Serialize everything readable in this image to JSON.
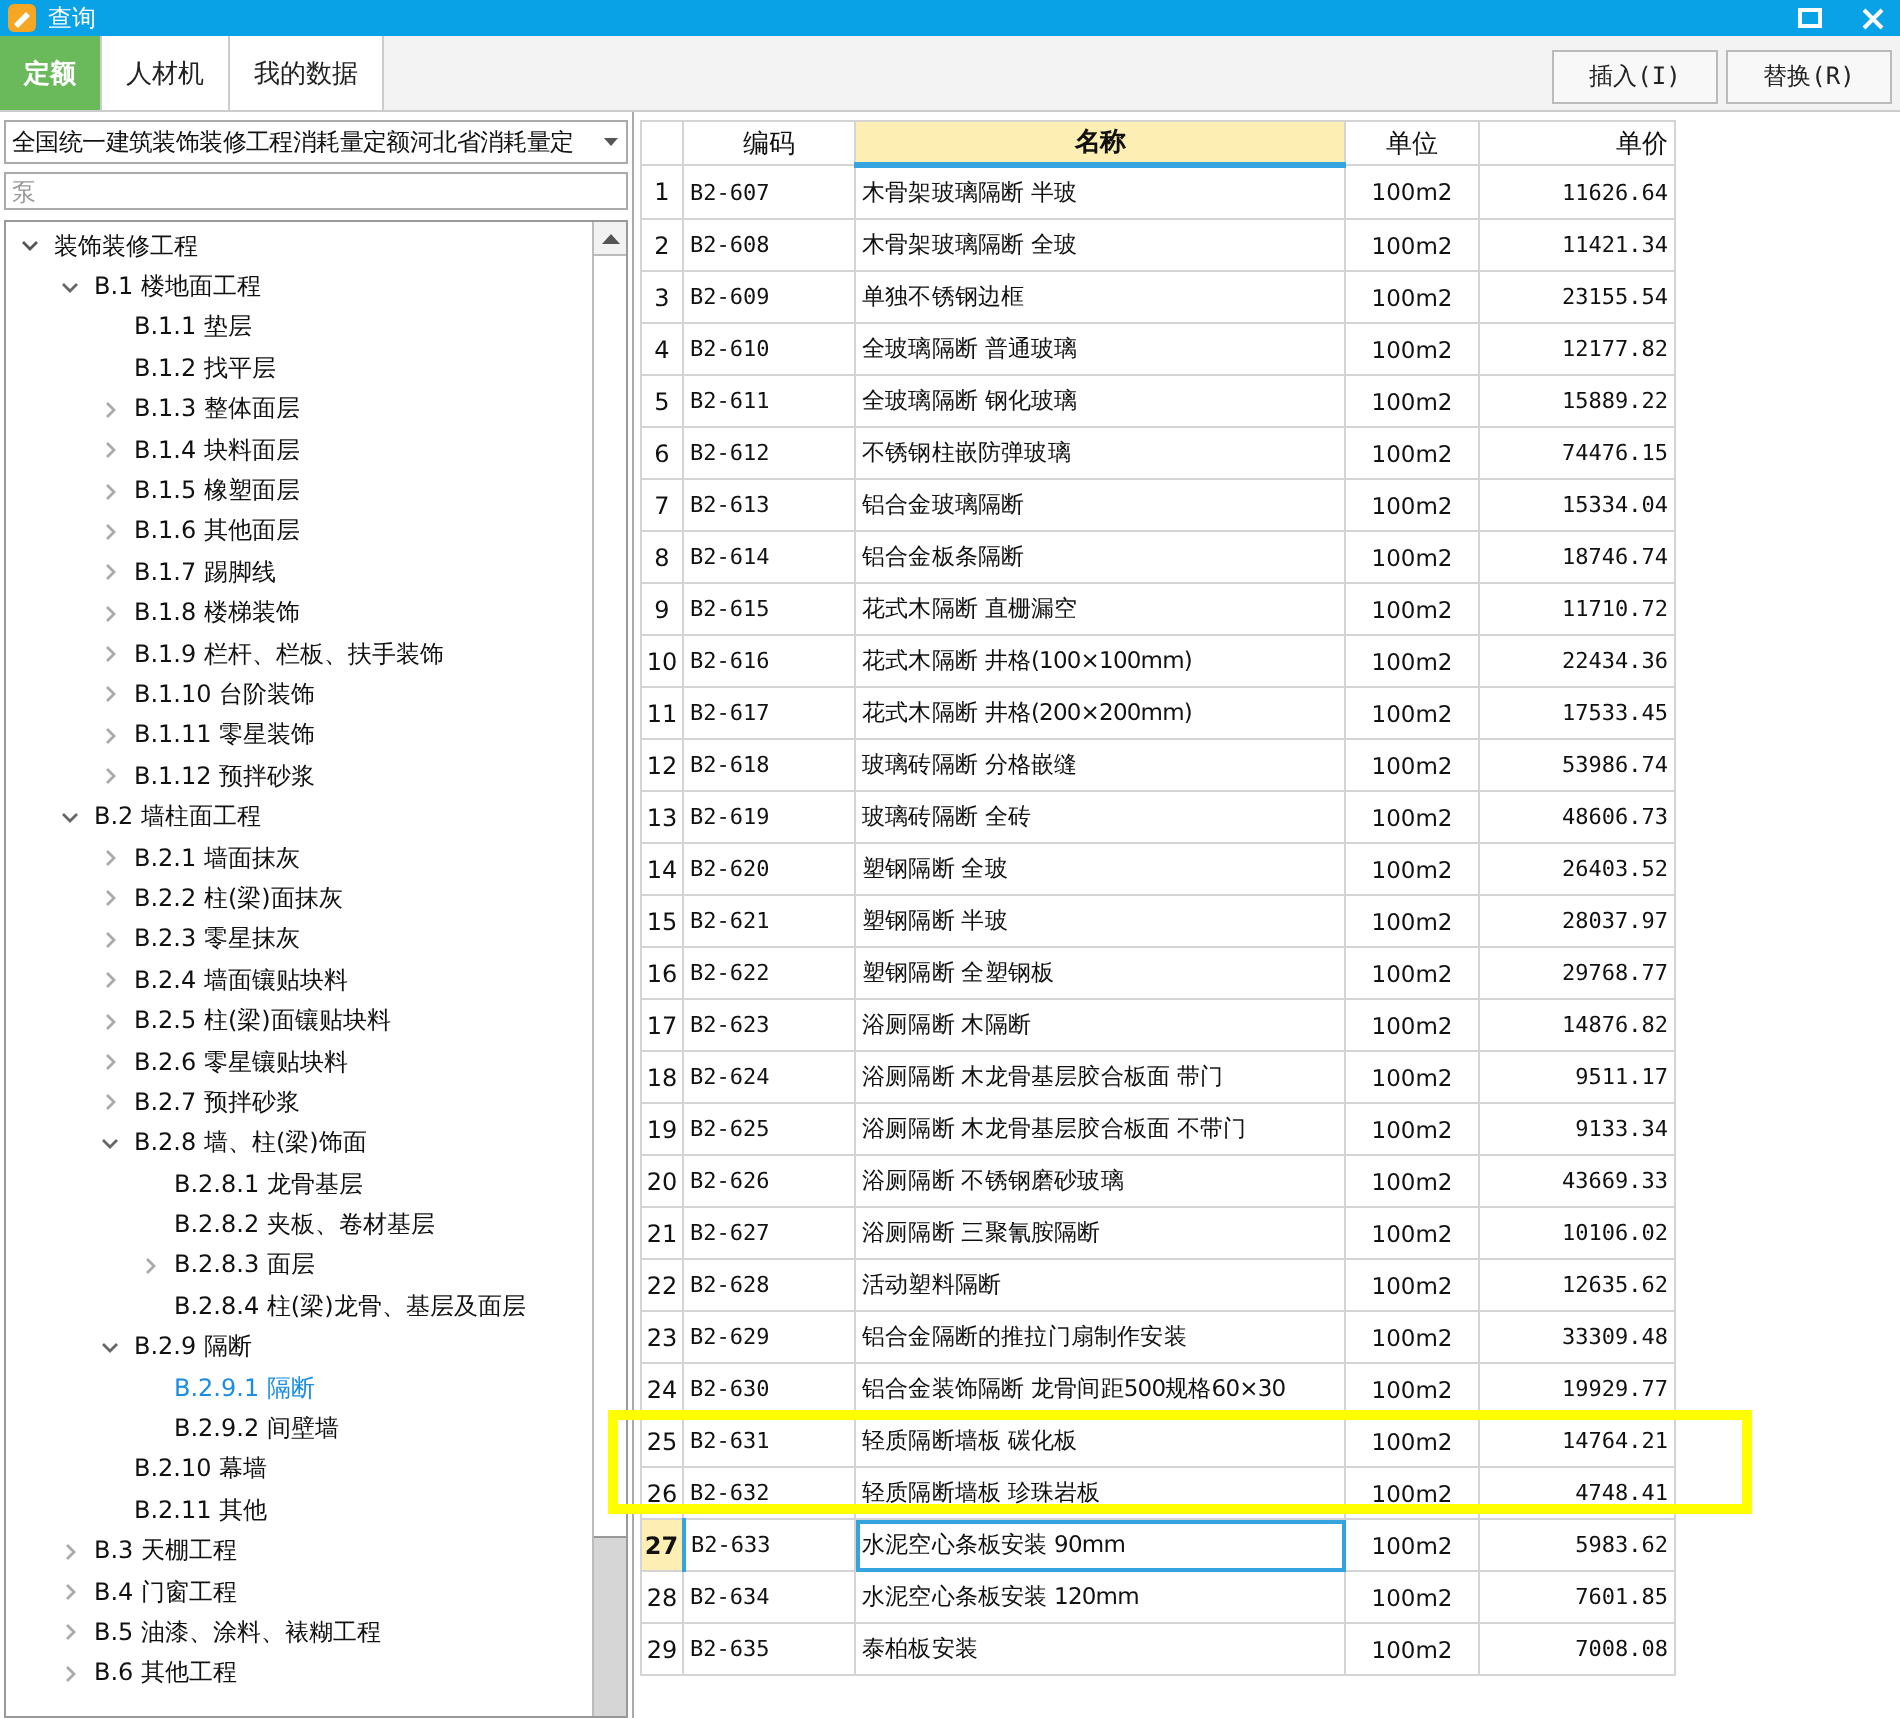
{
  "window": {
    "title": "查询"
  },
  "tabs": [
    {
      "label": "定额",
      "selected": true
    },
    {
      "label": "人材机",
      "selected": false
    },
    {
      "label": "我的数据",
      "selected": false
    }
  ],
  "buttons": [
    "插入(I)",
    "替换(R)"
  ],
  "library_select": {
    "value": "全国统一建筑装饰装修工程消耗量定额河北省消耗量定"
  },
  "search": {
    "placeholder": "泵"
  },
  "tree": [
    {
      "label": "装饰装修工程",
      "kind": "branch",
      "expanded": true,
      "selected": false,
      "children": [
        {
          "label": "B.1 楼地面工程",
          "kind": "branch",
          "expanded": true,
          "selected": false,
          "children": [
            {
              "label": "B.1.1 垫层",
              "kind": "leaf",
              "selected": false
            },
            {
              "label": "B.1.2 找平层",
              "kind": "leaf",
              "selected": false
            },
            {
              "label": "B.1.3 整体面层",
              "kind": "branch",
              "expanded": false,
              "selected": false
            },
            {
              "label": "B.1.4 块料面层",
              "kind": "branch",
              "expanded": false,
              "selected": false
            },
            {
              "label": "B.1.5 橡塑面层",
              "kind": "branch",
              "expanded": false,
              "selected": false
            },
            {
              "label": "B.1.6 其他面层",
              "kind": "branch",
              "expanded": false,
              "selected": false
            },
            {
              "label": "B.1.7 踢脚线",
              "kind": "branch",
              "expanded": false,
              "selected": false
            },
            {
              "label": "B.1.8 楼梯装饰",
              "kind": "branch",
              "expanded": false,
              "selected": false
            },
            {
              "label": "B.1.9 栏杆、栏板、扶手装饰",
              "kind": "branch",
              "expanded": false,
              "selected": false
            },
            {
              "label": "B.1.10 台阶装饰",
              "kind": "branch",
              "expanded": false,
              "selected": false
            },
            {
              "label": "B.1.11 零星装饰",
              "kind": "branch",
              "expanded": false,
              "selected": false
            },
            {
              "label": "B.1.12 预拌砂浆",
              "kind": "branch",
              "expanded": false,
              "selected": false
            }
          ]
        },
        {
          "label": "B.2 墙柱面工程",
          "kind": "branch",
          "expanded": true,
          "selected": false,
          "children": [
            {
              "label": "B.2.1 墙面抹灰",
              "kind": "branch",
              "expanded": false,
              "selected": false
            },
            {
              "label": "B.2.2 柱(梁)面抹灰",
              "kind": "branch",
              "expanded": false,
              "selected": false
            },
            {
              "label": "B.2.3 零星抹灰",
              "kind": "branch",
              "expanded": false,
              "selected": false
            },
            {
              "label": "B.2.4 墙面镶贴块料",
              "kind": "branch",
              "expanded": false,
              "selected": false
            },
            {
              "label": "B.2.5 柱(梁)面镶贴块料",
              "kind": "branch",
              "expanded": false,
              "selected": false
            },
            {
              "label": "B.2.6 零星镶贴块料",
              "kind": "branch",
              "expanded": false,
              "selected": false
            },
            {
              "label": "B.2.7 预拌砂浆",
              "kind": "branch",
              "expanded": false,
              "selected": false
            },
            {
              "label": "B.2.8 墙、柱(梁)饰面",
              "kind": "branch",
              "expanded": true,
              "selected": false,
              "children": [
                {
                  "label": "B.2.8.1 龙骨基层",
                  "kind": "leaf",
                  "selected": false
                },
                {
                  "label": "B.2.8.2 夹板、卷材基层",
                  "kind": "leaf",
                  "selected": false
                },
                {
                  "label": "B.2.8.3 面层",
                  "kind": "branch",
                  "expanded": false,
                  "selected": false
                },
                {
                  "label": "B.2.8.4 柱(梁)龙骨、基层及面层",
                  "kind": "leaf",
                  "selected": false
                }
              ]
            },
            {
              "label": "B.2.9 隔断",
              "kind": "branch",
              "expanded": true,
              "selected": false,
              "children": [
                {
                  "label": "B.2.9.1 隔断",
                  "kind": "leaf",
                  "selected": true
                },
                {
                  "label": "B.2.9.2 间壁墙",
                  "kind": "leaf",
                  "selected": false
                }
              ]
            },
            {
              "label": "B.2.10 幕墙",
              "kind": "leaf",
              "selected": false
            },
            {
              "label": "B.2.11 其他",
              "kind": "leaf",
              "selected": false
            }
          ]
        },
        {
          "label": "B.3 天棚工程",
          "kind": "branch",
          "expanded": false,
          "selected": false
        },
        {
          "label": "B.4 门窗工程",
          "kind": "branch",
          "expanded": false,
          "selected": false
        },
        {
          "label": "B.5 油漆、涂料、裱糊工程",
          "kind": "branch",
          "expanded": false,
          "selected": false
        },
        {
          "label": "B.6 其他工程",
          "kind": "branch",
          "expanded": false,
          "selected": false
        }
      ]
    }
  ],
  "table": {
    "columns": [
      {
        "label": "编码",
        "selected": false
      },
      {
        "label": "名称",
        "selected": true
      },
      {
        "label": "单位",
        "selected": false
      },
      {
        "label": "单价",
        "selected": false
      }
    ],
    "rows": [
      {
        "no": "1",
        "code": "B2-607",
        "name": "木骨架玻璃隔断 半玻",
        "unit": "100m2",
        "price": "11626.64",
        "selected": false,
        "highlighted": false
      },
      {
        "no": "2",
        "code": "B2-608",
        "name": "木骨架玻璃隔断 全玻",
        "unit": "100m2",
        "price": "11421.34",
        "selected": false,
        "highlighted": false
      },
      {
        "no": "3",
        "code": "B2-609",
        "name": "单独不锈钢边框",
        "unit": "100m2",
        "price": "23155.54",
        "selected": false,
        "highlighted": false
      },
      {
        "no": "4",
        "code": "B2-610",
        "name": "全玻璃隔断 普通玻璃",
        "unit": "100m2",
        "price": "12177.82",
        "selected": false,
        "highlighted": false
      },
      {
        "no": "5",
        "code": "B2-611",
        "name": "全玻璃隔断 钢化玻璃",
        "unit": "100m2",
        "price": "15889.22",
        "selected": false,
        "highlighted": false
      },
      {
        "no": "6",
        "code": "B2-612",
        "name": "不锈钢柱嵌防弹玻璃",
        "unit": "100m2",
        "price": "74476.15",
        "selected": false,
        "highlighted": false
      },
      {
        "no": "7",
        "code": "B2-613",
        "name": "铝合金玻璃隔断",
        "unit": "100m2",
        "price": "15334.04",
        "selected": false,
        "highlighted": false
      },
      {
        "no": "8",
        "code": "B2-614",
        "name": "铝合金板条隔断",
        "unit": "100m2",
        "price": "18746.74",
        "selected": false,
        "highlighted": false
      },
      {
        "no": "9",
        "code": "B2-615",
        "name": "花式木隔断 直栅漏空",
        "unit": "100m2",
        "price": "11710.72",
        "selected": false,
        "highlighted": false
      },
      {
        "no": "10",
        "code": "B2-616",
        "name": "花式木隔断 井格(100×100mm)",
        "unit": "100m2",
        "price": "22434.36",
        "selected": false,
        "highlighted": false
      },
      {
        "no": "11",
        "code": "B2-617",
        "name": "花式木隔断 井格(200×200mm)",
        "unit": "100m2",
        "price": "17533.45",
        "selected": false,
        "highlighted": false
      },
      {
        "no": "12",
        "code": "B2-618",
        "name": "玻璃砖隔断 分格嵌缝",
        "unit": "100m2",
        "price": "53986.74",
        "selected": false,
        "highlighted": false
      },
      {
        "no": "13",
        "code": "B2-619",
        "name": "玻璃砖隔断 全砖",
        "unit": "100m2",
        "price": "48606.73",
        "selected": false,
        "highlighted": false
      },
      {
        "no": "14",
        "code": "B2-620",
        "name": "塑钢隔断 全玻",
        "unit": "100m2",
        "price": "26403.52",
        "selected": false,
        "highlighted": false
      },
      {
        "no": "15",
        "code": "B2-621",
        "name": "塑钢隔断 半玻",
        "unit": "100m2",
        "price": "28037.97",
        "selected": false,
        "highlighted": false
      },
      {
        "no": "16",
        "code": "B2-622",
        "name": "塑钢隔断 全塑钢板",
        "unit": "100m2",
        "price": "29768.77",
        "selected": false,
        "highlighted": false
      },
      {
        "no": "17",
        "code": "B2-623",
        "name": "浴厕隔断 木隔断",
        "unit": "100m2",
        "price": "14876.82",
        "selected": false,
        "highlighted": false
      },
      {
        "no": "18",
        "code": "B2-624",
        "name": "浴厕隔断 木龙骨基层胶合板面 带门",
        "unit": "100m2",
        "price": "9511.17",
        "selected": false,
        "highlighted": false
      },
      {
        "no": "19",
        "code": "B2-625",
        "name": "浴厕隔断 木龙骨基层胶合板面 不带门",
        "unit": "100m2",
        "price": "9133.34",
        "selected": false,
        "highlighted": false
      },
      {
        "no": "20",
        "code": "B2-626",
        "name": "浴厕隔断 不锈钢磨砂玻璃",
        "unit": "100m2",
        "price": "43669.33",
        "selected": false,
        "highlighted": false
      },
      {
        "no": "21",
        "code": "B2-627",
        "name": "浴厕隔断 三聚氰胺隔断",
        "unit": "100m2",
        "price": "10106.02",
        "selected": false,
        "highlighted": false
      },
      {
        "no": "22",
        "code": "B2-628",
        "name": "活动塑料隔断",
        "unit": "100m2",
        "price": "12635.62",
        "selected": false,
        "highlighted": false
      },
      {
        "no": "23",
        "code": "B2-629",
        "name": "铝合金隔断的推拉门扇制作安装",
        "unit": "100m2",
        "price": "33309.48",
        "selected": false,
        "highlighted": false
      },
      {
        "no": "24",
        "code": "B2-630",
        "name": "铝合金装饰隔断 龙骨间距500规格60×30",
        "unit": "100m2",
        "price": "19929.77",
        "selected": false,
        "highlighted": false
      },
      {
        "no": "25",
        "code": "B2-631",
        "name": "轻质隔断墙板 碳化板",
        "unit": "100m2",
        "price": "14764.21",
        "selected": false,
        "highlighted": true
      },
      {
        "no": "26",
        "code": "B2-632",
        "name": "轻质隔断墙板 珍珠岩板",
        "unit": "100m2",
        "price": "4748.41",
        "selected": false,
        "highlighted": true
      },
      {
        "no": "27",
        "code": "B2-633",
        "name": "水泥空心条板安装 90mm",
        "unit": "100m2",
        "price": "5983.62",
        "selected": true,
        "highlighted": false
      },
      {
        "no": "28",
        "code": "B2-634",
        "name": "水泥空心条板安装 120mm",
        "unit": "100m2",
        "price": "7601.85",
        "selected": false,
        "highlighted": false
      },
      {
        "no": "29",
        "code": "B2-635",
        "name": "泰柏板安装",
        "unit": "100m2",
        "price": "7008.08",
        "selected": false,
        "highlighted": false
      }
    ]
  }
}
